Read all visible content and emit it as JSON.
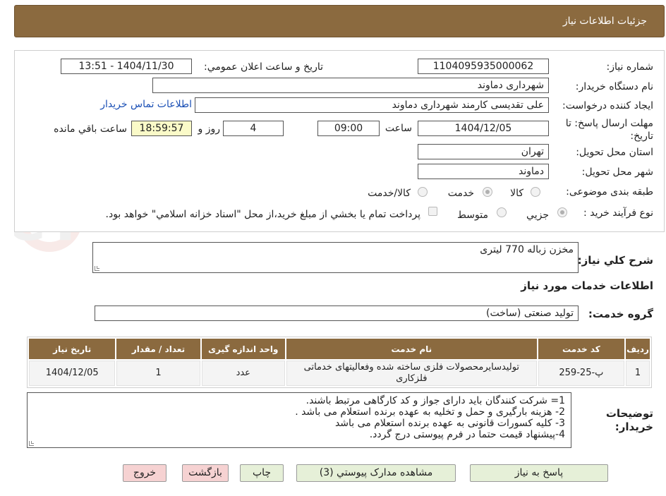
{
  "header": {
    "title": "جزئيات اطلاعات نياز"
  },
  "watermark": {
    "text": "AriaTender.neT"
  },
  "fields": {
    "need_number_label": "شماره نياز:",
    "need_number": "1104095935000062",
    "announce_label": "تاريخ و ساعت اعلان عمومي:",
    "announce_value": "1404/11/30 - 13:51",
    "buyer_org_label": "نام دستگاه خريدار:",
    "buyer_org": "شهرداری دماوند",
    "requester_label": "ايجاد کننده درخواست:",
    "requester": "علی تقدیسی کارمند شهرداری دماوند",
    "contact_link": "اطلاعات تماس خريدار",
    "deadline_label": "مهلت ارسال پاسخ: تا تاريخ:",
    "deadline_date": "1404/12/05",
    "time_label": "ساعت",
    "deadline_time": "09:00",
    "days_value": "4",
    "days_label": "روز و",
    "remaining_time": "18:59:57",
    "remaining_label": "ساعت باقي مانده",
    "province_label": "استان محل تحويل:",
    "province": "تهران",
    "city_label": "شهر محل تحويل:",
    "city": "دماوند",
    "category_label": "طبقه بندی موضوعی:",
    "category_options": [
      "کالا",
      "خدمت",
      "کالا/خدمت"
    ],
    "category_selected": "خدمت",
    "process_label": "نوع فرآيند خريد :",
    "process_options": [
      "جزيي",
      "متوسط"
    ],
    "process_selected": "جزيي",
    "payment_note": "پرداخت تمام يا بخشي از مبلغ خريد،از محل \"اسناد خزانه اسلامي\" خواهد بود."
  },
  "description": {
    "label": "شرح کلي نياز:",
    "value": "مخزن زباله 770 لیتری"
  },
  "services_title": "اطلاعات خدمات مورد نياز",
  "service_group": {
    "label": "گروه خدمت:",
    "value": "تولید صنعتی (ساخت)"
  },
  "table": {
    "headers": [
      "رديف",
      "کد خدمت",
      "نام خدمت",
      "واحد اندازه گيری",
      "تعداد / مقدار",
      "تاريخ نياز"
    ],
    "rows": [
      [
        "1",
        "پ-25-259",
        "تولیدسایرمحصولات فلزی ساخته شده وفعالیتهای خدماتی فلزکاری",
        "عدد",
        "1",
        "1404/12/05"
      ]
    ]
  },
  "notes": {
    "label": "توضيحات خريدار:",
    "lines": [
      "1= شرکت کنندگان باید دارای جواز و کد کارگاهی مرتبط باشند.",
      "2- هزینه بارگیری و حمل و تخلیه به عهده برنده استعلام می باشد .",
      "3- کلیه کسورات قانونی به عهده برنده استعلام می باشد",
      "4-پیشنهاد قیمت حتما در فرم پیوستی درج گردد."
    ]
  },
  "buttons": {
    "reply": "پاسخ به نياز",
    "attachments": "مشاهده مدارک پيوستي (3)",
    "print": "چاپ",
    "back": "بازگشت",
    "exit": "خروج"
  }
}
